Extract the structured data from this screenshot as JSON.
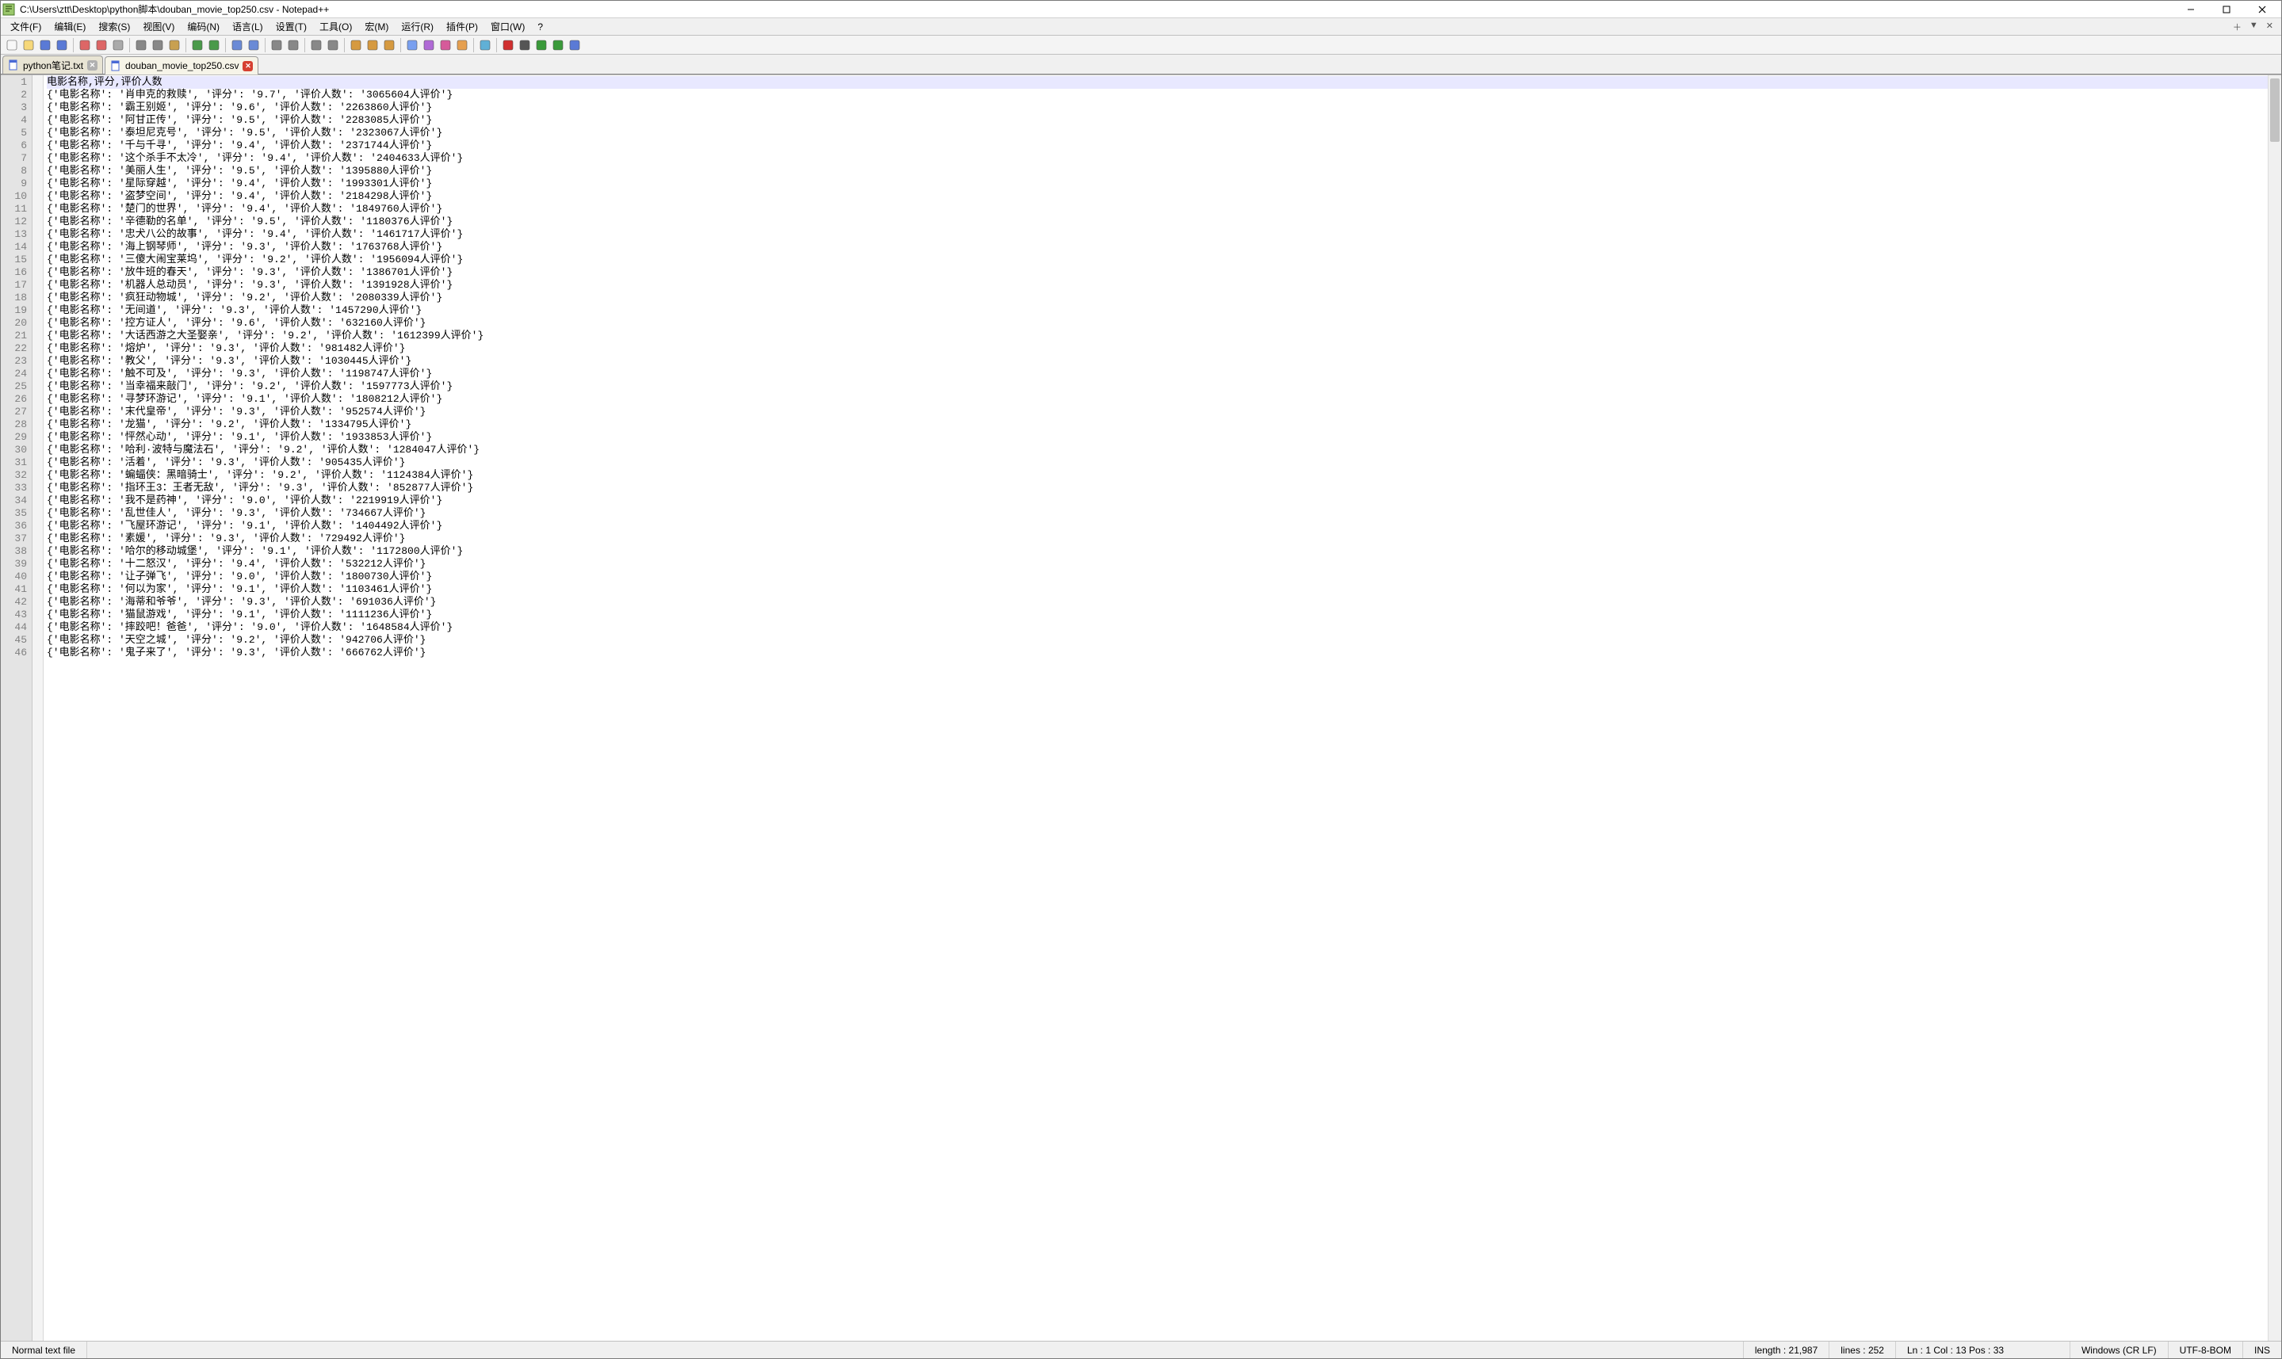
{
  "window": {
    "title": "C:\\Users\\ztt\\Desktop\\python脚本\\douban_movie_top250.csv - Notepad++",
    "icon_name": "notepadpp-icon"
  },
  "menu": {
    "items": [
      "文件(F)",
      "编辑(E)",
      "搜索(S)",
      "视图(V)",
      "编码(N)",
      "语言(L)",
      "设置(T)",
      "工具(O)",
      "宏(M)",
      "运行(R)",
      "插件(P)",
      "窗口(W)",
      "?"
    ],
    "right_icons": [
      "plus-icon",
      "chevron-down-icon",
      "x-icon"
    ]
  },
  "toolbar_groups": [
    [
      "new-file-icon",
      "open-file-icon",
      "save-icon",
      "save-all-icon"
    ],
    [
      "close-icon",
      "close-all-icon",
      "print-icon"
    ],
    [
      "cut-icon",
      "copy-icon",
      "paste-icon"
    ],
    [
      "undo-icon",
      "redo-icon"
    ],
    [
      "find-icon",
      "replace-icon"
    ],
    [
      "zoom-in-icon",
      "zoom-out-icon"
    ],
    [
      "sync-v-icon",
      "sync-h-icon"
    ],
    [
      "wordwrap-icon",
      "allchars-icon",
      "indent-guide-icon"
    ],
    [
      "lang-icon",
      "doc-map-icon",
      "func-list-icon",
      "folder-icon"
    ],
    [
      "monitor-icon"
    ],
    [
      "record-icon",
      "stop-icon",
      "play-icon",
      "play-multi-icon",
      "save-macro-icon"
    ]
  ],
  "tabs": [
    {
      "label": "python笔记.txt",
      "active": false,
      "dirty": false
    },
    {
      "label": "douban_movie_top250.csv",
      "active": true,
      "dirty": true
    }
  ],
  "editor": {
    "first_line_number": 1,
    "lines": [
      "电影名称,评分,评价人数",
      "{'电影名称': '肖申克的救赎', '评分': '9.7', '评价人数': '3065604人评价'}",
      "{'电影名称': '霸王别姬', '评分': '9.6', '评价人数': '2263860人评价'}",
      "{'电影名称': '阿甘正传', '评分': '9.5', '评价人数': '2283085人评价'}",
      "{'电影名称': '泰坦尼克号', '评分': '9.5', '评价人数': '2323067人评价'}",
      "{'电影名称': '千与千寻', '评分': '9.4', '评价人数': '2371744人评价'}",
      "{'电影名称': '这个杀手不太冷', '评分': '9.4', '评价人数': '2404633人评价'}",
      "{'电影名称': '美丽人生', '评分': '9.5', '评价人数': '1395880人评价'}",
      "{'电影名称': '星际穿越', '评分': '9.4', '评价人数': '1993301人评价'}",
      "{'电影名称': '盗梦空间', '评分': '9.4', '评价人数': '2184298人评价'}",
      "{'电影名称': '楚门的世界', '评分': '9.4', '评价人数': '1849760人评价'}",
      "{'电影名称': '辛德勒的名单', '评分': '9.5', '评价人数': '1180376人评价'}",
      "{'电影名称': '忠犬八公的故事', '评分': '9.4', '评价人数': '1461717人评价'}",
      "{'电影名称': '海上钢琴师', '评分': '9.3', '评价人数': '1763768人评价'}",
      "{'电影名称': '三傻大闹宝莱坞', '评分': '9.2', '评价人数': '1956094人评价'}",
      "{'电影名称': '放牛班的春天', '评分': '9.3', '评价人数': '1386701人评价'}",
      "{'电影名称': '机器人总动员', '评分': '9.3', '评价人数': '1391928人评价'}",
      "{'电影名称': '疯狂动物城', '评分': '9.2', '评价人数': '2080339人评价'}",
      "{'电影名称': '无间道', '评分': '9.3', '评价人数': '1457290人评价'}",
      "{'电影名称': '控方证人', '评分': '9.6', '评价人数': '632160人评价'}",
      "{'电影名称': '大话西游之大圣娶亲', '评分': '9.2', '评价人数': '1612399人评价'}",
      "{'电影名称': '熔炉', '评分': '9.3', '评价人数': '981482人评价'}",
      "{'电影名称': '教父', '评分': '9.3', '评价人数': '1030445人评价'}",
      "{'电影名称': '触不可及', '评分': '9.3', '评价人数': '1198747人评价'}",
      "{'电影名称': '当幸福来敲门', '评分': '9.2', '评价人数': '1597773人评价'}",
      "{'电影名称': '寻梦环游记', '评分': '9.1', '评价人数': '1808212人评价'}",
      "{'电影名称': '末代皇帝', '评分': '9.3', '评价人数': '952574人评价'}",
      "{'电影名称': '龙猫', '评分': '9.2', '评价人数': '1334795人评价'}",
      "{'电影名称': '怦然心动', '评分': '9.1', '评价人数': '1933853人评价'}",
      "{'电影名称': '哈利·波特与魔法石', '评分': '9.2', '评价人数': '1284047人评价'}",
      "{'电影名称': '活着', '评分': '9.3', '评价人数': '905435人评价'}",
      "{'电影名称': '蝙蝠侠：黑暗骑士', '评分': '9.2', '评价人数': '1124384人评价'}",
      "{'电影名称': '指环王3：王者无敌', '评分': '9.3', '评价人数': '852877人评价'}",
      "{'电影名称': '我不是药神', '评分': '9.0', '评价人数': '2219919人评价'}",
      "{'电影名称': '乱世佳人', '评分': '9.3', '评价人数': '734667人评价'}",
      "{'电影名称': '飞屋环游记', '评分': '9.1', '评价人数': '1404492人评价'}",
      "{'电影名称': '素媛', '评分': '9.3', '评价人数': '729492人评价'}",
      "{'电影名称': '哈尔的移动城堡', '评分': '9.1', '评价人数': '1172800人评价'}",
      "{'电影名称': '十二怒汉', '评分': '9.4', '评价人数': '532212人评价'}",
      "{'电影名称': '让子弹飞', '评分': '9.0', '评价人数': '1800730人评价'}",
      "{'电影名称': '何以为家', '评分': '9.1', '评价人数': '1103461人评价'}",
      "{'电影名称': '海蒂和爷爷', '评分': '9.3', '评价人数': '691036人评价'}",
      "{'电影名称': '猫鼠游戏', '评分': '9.1', '评价人数': '1111236人评价'}",
      "{'电影名称': '摔跤吧！爸爸', '评分': '9.0', '评价人数': '1648584人评价'}",
      "{'电影名称': '天空之城', '评分': '9.2', '评价人数': '942706人评价'}",
      "{'电影名称': '鬼子来了', '评分': '9.3', '评价人数': '666762人评价'}"
    ],
    "current_line_index": 0
  },
  "statusbar": {
    "filetype": "Normal text file",
    "length_label": "length : 21,987",
    "lines_label": "lines : 252",
    "position_label": "Ln : 1    Col : 13    Pos : 33",
    "eol": "Windows (CR LF)",
    "encoding": "UTF-8-BOM",
    "mode": "INS"
  }
}
